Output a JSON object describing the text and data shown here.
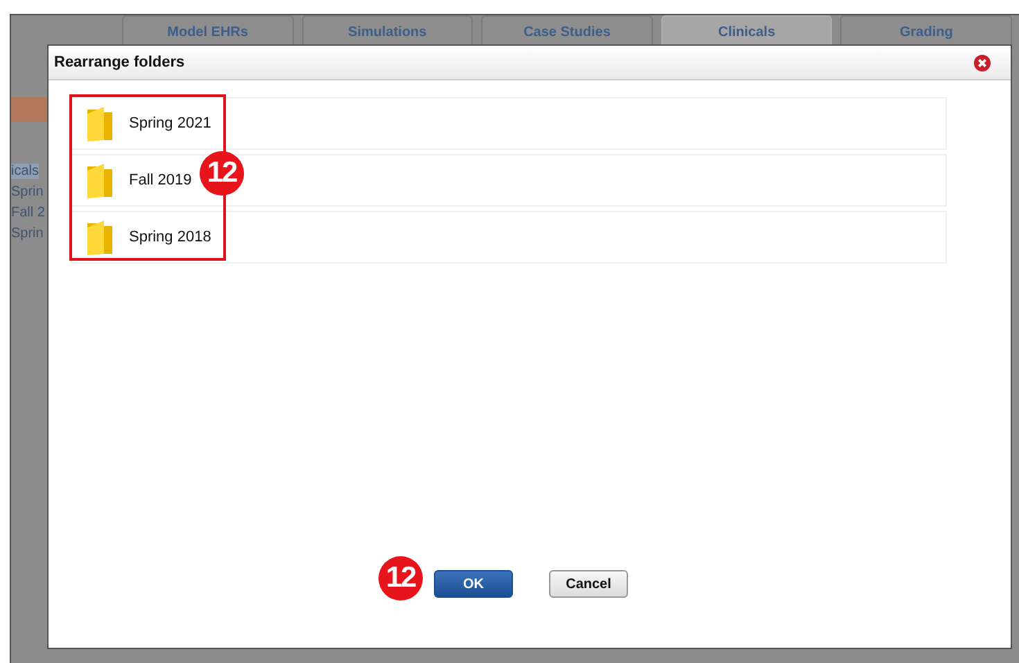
{
  "app": {
    "tabs": [
      {
        "label": "Model EHRs",
        "selected": false
      },
      {
        "label": "Simulations",
        "selected": false
      },
      {
        "label": "Case Studies",
        "selected": false
      },
      {
        "label": "Clinicals",
        "selected": true
      },
      {
        "label": "Grading",
        "selected": false
      }
    ],
    "sidebar": {
      "items": [
        {
          "label": "icals",
          "selected": true
        },
        {
          "label": "Sprin",
          "selected": false
        },
        {
          "label": "Fall 2",
          "selected": false
        },
        {
          "label": "Sprin",
          "selected": false
        }
      ]
    }
  },
  "dialog": {
    "title": "Rearrange folders",
    "folders": [
      {
        "name": "Spring 2021"
      },
      {
        "name": "Fall 2019"
      },
      {
        "name": "Spring 2018"
      }
    ],
    "buttons": [
      {
        "label": "OK",
        "kind": "primary"
      },
      {
        "label": "Cancel",
        "kind": "secondary"
      }
    ]
  },
  "folder_callout": "12",
  "button_callout": "12"
}
